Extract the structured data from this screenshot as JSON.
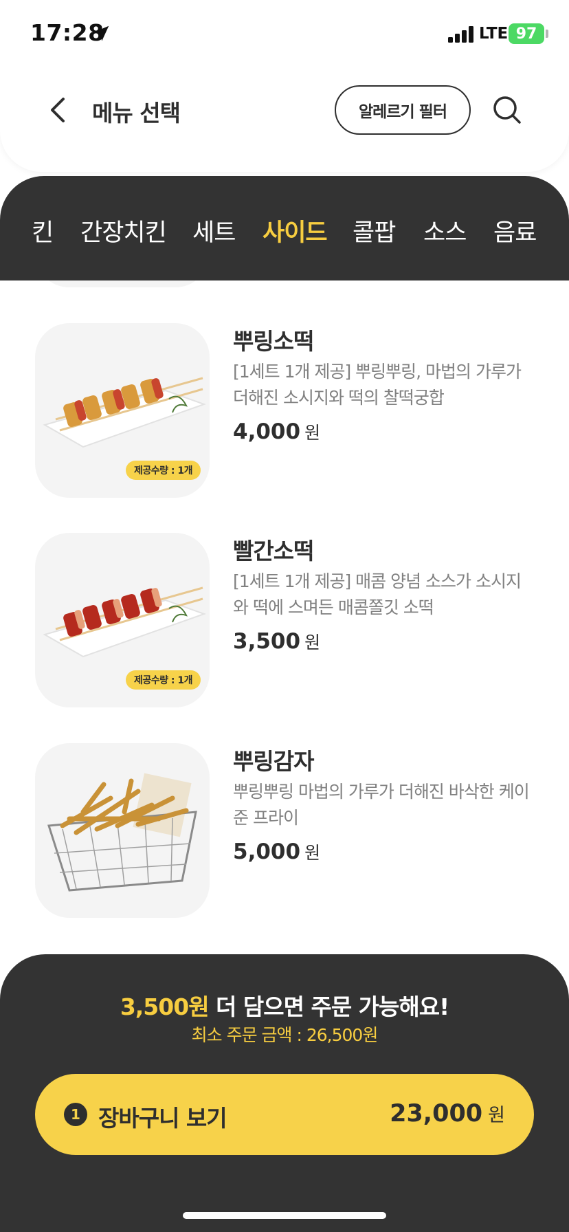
{
  "status_bar": {
    "time": "17:28",
    "network": "LTE",
    "battery": "97"
  },
  "header": {
    "title": "메뉴 선택",
    "allergy_filter_label": "알레르기 필터"
  },
  "categories": [
    "킨",
    "간장치킨",
    "세트",
    "사이드",
    "콜팝",
    "소스",
    "음료"
  ],
  "active_category": "사이드",
  "menu_items": [
    {
      "name": "뿌링소떡",
      "description": "[1세트 1개 제공] 뿌링뿌링, 마법의 가루가 더해진 소시지와 떡의 찰떡궁합",
      "price": "4,000",
      "unit": "원",
      "badge": "제공수량 : 1개",
      "image": "sotteok-cheese"
    },
    {
      "name": "빨간소떡",
      "description": "[1세트 1개 제공] 매콤 양념 소스가 소시지와 떡에 스며든 매콤쫄깃 소떡",
      "price": "3,500",
      "unit": "원",
      "badge": "제공수량 : 1개",
      "image": "sotteok-red"
    },
    {
      "name": "뿌링감자",
      "description": "뿌링뿌링 마법의 가루가 더해진 바삭한 케이준 프라이",
      "price": "5,000",
      "unit": "원",
      "image": "fries-basket"
    }
  ],
  "order_notice": {
    "amount_needed": "3,500원",
    "message": " 더 담으면 주문 가능해요!",
    "min_order": "최소 주문 금액 : 26,500원"
  },
  "cart": {
    "count": "1",
    "label": "장바구니 보기",
    "total": "23,000",
    "unit": "원"
  },
  "colors": {
    "accent": "#f7cd40",
    "dark": "#333333",
    "button": "#f7d24a",
    "card_bg": "#f4f4f4"
  }
}
